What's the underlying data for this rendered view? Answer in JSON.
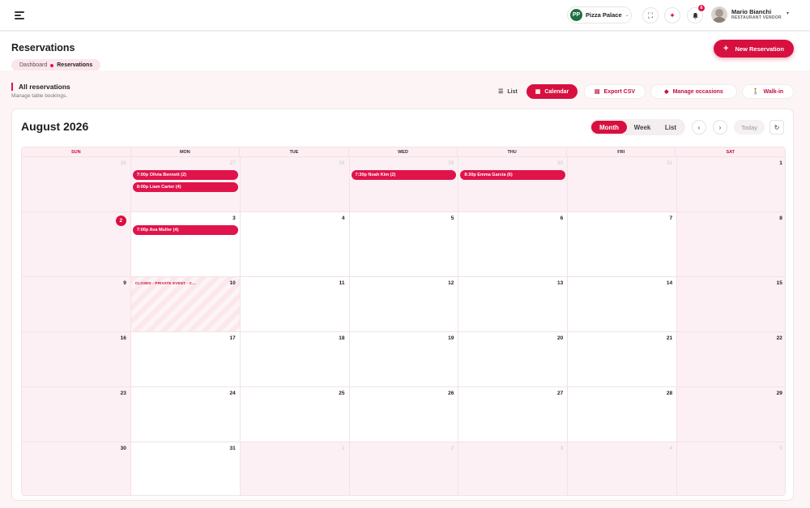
{
  "topbar": {
    "restaurant": {
      "logo": "PP",
      "name": "Pizza Palace"
    },
    "buttons": [
      {
        "icon": "fullscreen-icon",
        "glyph": "⛶"
      },
      {
        "icon": "sparkle-icon",
        "glyph": "✦"
      },
      {
        "icon": "bell-icon",
        "glyph": "🔔",
        "badge": "6"
      }
    ],
    "user": {
      "name": "Mario Bianchi",
      "role": "RESTAURANT VENDOR"
    }
  },
  "header": {
    "title": "Reservations",
    "breadcrumb": {
      "home": "Dashboard",
      "current": "Reservations"
    },
    "new_button": "New Reservation"
  },
  "section": {
    "title": "All reservations",
    "subtitle": "Manage table bookings.",
    "views": {
      "list": "List",
      "calendar": "Calendar",
      "export": "Export CSV",
      "occasions": "Manage occasions",
      "walkin": "Walk-in"
    }
  },
  "calendar": {
    "title": "August 2026",
    "modes": {
      "month": "Month",
      "week": "Week",
      "list": "List"
    },
    "active_mode": "Month",
    "today_label": "Today",
    "weekdays": [
      "SUN",
      "MON",
      "TUE",
      "WED",
      "THU",
      "FRI",
      "SAT"
    ],
    "weeks": [
      [
        {
          "n": "26",
          "other": true
        },
        {
          "n": "27",
          "other": true,
          "events": [
            "7:00p  Olivia Bennett (2)",
            "8:00p  Liam Carter (4)"
          ]
        },
        {
          "n": "28",
          "other": true
        },
        {
          "n": "29",
          "other": true,
          "events": [
            "7:30p  Noah Kim (2)"
          ]
        },
        {
          "n": "30",
          "other": true,
          "events": [
            "8:30p  Emma Garcia (6)"
          ]
        },
        {
          "n": "31",
          "other": true
        },
        {
          "n": "1"
        }
      ],
      [
        {
          "n": "2",
          "today": true
        },
        {
          "n": "3",
          "events": [
            "7:00p  Ava Muller (4)"
          ]
        },
        {
          "n": "4"
        },
        {
          "n": "5"
        },
        {
          "n": "6"
        },
        {
          "n": "7"
        },
        {
          "n": "8"
        }
      ],
      [
        {
          "n": "9"
        },
        {
          "n": "10",
          "closed": "CLOSED - PRIVATE EVENT - C..."
        },
        {
          "n": "11"
        },
        {
          "n": "12"
        },
        {
          "n": "13"
        },
        {
          "n": "14"
        },
        {
          "n": "15"
        }
      ],
      [
        {
          "n": "16"
        },
        {
          "n": "17"
        },
        {
          "n": "18"
        },
        {
          "n": "19"
        },
        {
          "n": "20"
        },
        {
          "n": "21"
        },
        {
          "n": "22"
        }
      ],
      [
        {
          "n": "23"
        },
        {
          "n": "24"
        },
        {
          "n": "25"
        },
        {
          "n": "26"
        },
        {
          "n": "27"
        },
        {
          "n": "28"
        },
        {
          "n": "29"
        }
      ],
      [
        {
          "n": "30"
        },
        {
          "n": "31"
        },
        {
          "n": "1",
          "other": true
        },
        {
          "n": "2",
          "other": true
        },
        {
          "n": "3",
          "other": true
        },
        {
          "n": "4",
          "other": true
        },
        {
          "n": "5",
          "other": true
        }
      ]
    ]
  },
  "colors": {
    "accent": "#d8103f",
    "event": "#e0134a",
    "weekend_bg": "#fdf0f4"
  }
}
